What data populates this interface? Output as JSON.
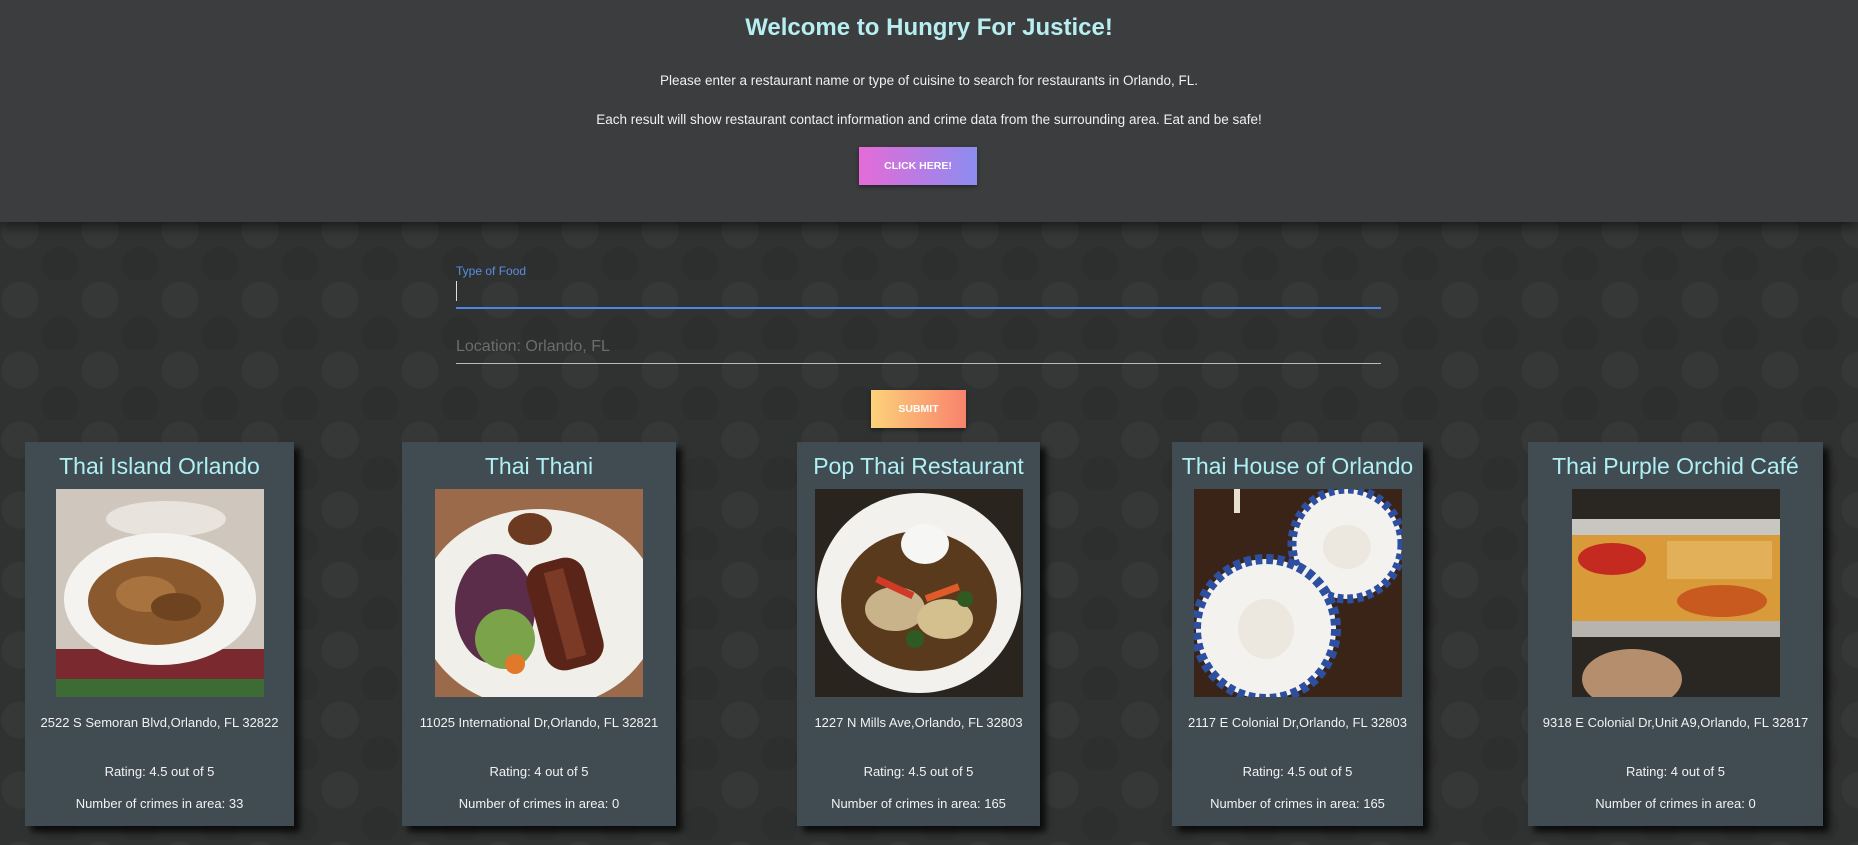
{
  "hero": {
    "title": "Welcome to Hungry For Justice!",
    "line1": "Please enter a restaurant name or type of cuisine to search for restaurants in Orlando, FL.",
    "line2": "Each result will show restaurant contact information and crime data from the surrounding area. Eat and be safe!",
    "button_label": "CLICK HERE!"
  },
  "search": {
    "food_label": "Type of Food",
    "food_value": "",
    "location_placeholder": "Location: Orlando, FL",
    "submit_label": "SUBMIT"
  },
  "results": [
    {
      "name": "Thai Island Orlando",
      "address": "2522 S Semoran Blvd,Orlando, FL 32822",
      "rating": "Rating: 4.5 out of 5",
      "crimes": "Number of crimes in area: 33",
      "photo_icon": "noodle-plate-photo"
    },
    {
      "name": "Thai Thani",
      "address": "11025 International Dr,Orlando, FL 32821",
      "rating": "Rating: 4 out of 5",
      "crimes": "Number of crimes in area: 0",
      "photo_icon": "steak-salad-photo"
    },
    {
      "name": "Pop Thai Restaurant",
      "address": "1227 N Mills Ave,Orlando, FL 32803",
      "rating": "Rating: 4.5 out of 5",
      "crimes": "Number of crimes in area: 165",
      "photo_icon": "curry-bowl-photo"
    },
    {
      "name": "Thai House of Orlando",
      "address": "2117 E Colonial Dr,Orlando, FL 32803",
      "rating": "Rating: 4.5 out of 5",
      "crimes": "Number of crimes in area: 165",
      "photo_icon": "rice-plates-photo"
    },
    {
      "name": "Thai Purple Orchid Café",
      "address": "9318 E Colonial Dr,Unit A9,Orlando, FL 32817",
      "rating": "Rating: 4 out of 5",
      "crimes": "Number of crimes in area: 0",
      "photo_icon": "curry-paste-can-photo"
    }
  ]
}
